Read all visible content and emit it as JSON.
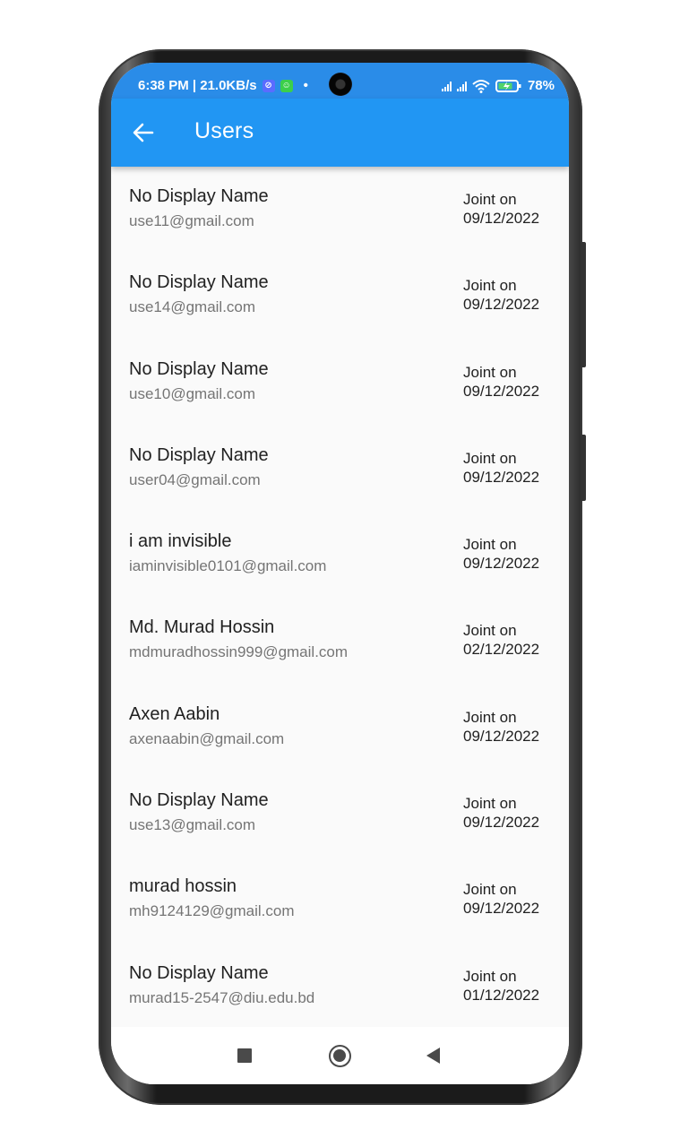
{
  "status_bar": {
    "time_speed": "6:38 PM | 21.0KB/s",
    "dot": "•",
    "battery": "78%"
  },
  "app_bar": {
    "title": "Users"
  },
  "users": [
    {
      "name": "No Display Name",
      "email": "use11@gmail.com",
      "joined_label": "Joint on",
      "joined_date": "09/12/2022"
    },
    {
      "name": "No Display Name",
      "email": "use14@gmail.com",
      "joined_label": "Joint on",
      "joined_date": "09/12/2022"
    },
    {
      "name": "No Display Name",
      "email": "use10@gmail.com",
      "joined_label": "Joint on",
      "joined_date": "09/12/2022"
    },
    {
      "name": "No Display Name",
      "email": "user04@gmail.com",
      "joined_label": "Joint on",
      "joined_date": "09/12/2022"
    },
    {
      "name": "i am invisible",
      "email": "iaminvisible0101@gmail.com",
      "joined_label": "Joint on",
      "joined_date": "09/12/2022"
    },
    {
      "name": "Md. Murad Hossin",
      "email": "mdmuradhossin999@gmail.com",
      "joined_label": "Joint on",
      "joined_date": "02/12/2022"
    },
    {
      "name": "Axen Aabin",
      "email": "axenaabin@gmail.com",
      "joined_label": "Joint on",
      "joined_date": "09/12/2022"
    },
    {
      "name": "No Display Name",
      "email": "use13@gmail.com",
      "joined_label": "Joint on",
      "joined_date": "09/12/2022"
    },
    {
      "name": "murad hossin",
      "email": "mh9124129@gmail.com",
      "joined_label": "Joint on",
      "joined_date": "09/12/2022"
    },
    {
      "name": "No Display Name",
      "email": "murad15-2547@diu.edu.bd",
      "joined_label": "Joint on",
      "joined_date": "01/12/2022"
    }
  ],
  "colors": {
    "app_bar": "#2196f3",
    "status_bar": "#2a8ce8",
    "background": "#fafafa",
    "primary_text": "#212121",
    "secondary_text": "#757575"
  }
}
